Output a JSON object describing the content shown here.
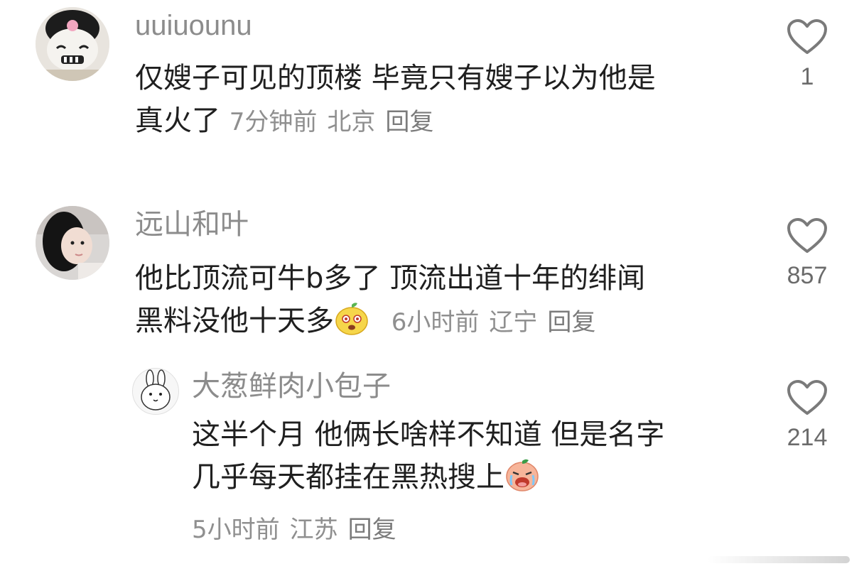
{
  "comments": [
    {
      "username": "uuiuounu",
      "text_line1": "仅嫂子可见的顶楼 毕竟只有嫂子以为他是",
      "text_line2": "真火了",
      "time": "7分钟前",
      "location": "北京",
      "reply_label": "回复",
      "likes": "1",
      "avatar_icon": "skull-character-avatar"
    },
    {
      "username": "远山和叶",
      "text_line1": "他比顶流可牛b多了 顶流出道十年的绯闻",
      "text_line2": "黑料没他十天多",
      "time": "6小时前",
      "location": "辽宁",
      "reply_label": "回复",
      "likes": "857",
      "avatar_icon": "girl-photo-avatar"
    },
    {
      "username": "大葱鲜肉小包子",
      "text_line1": "这半个月 他俩长啥样不知道 但是名字",
      "text_line2": "几乎每天都挂在黑热搜上",
      "time": "5小时前",
      "location": "江苏",
      "reply_label": "回复",
      "likes": "214",
      "avatar_icon": "bunny-doodle-avatar"
    }
  ],
  "colors": {
    "text": "#1f1f1f",
    "meta": "#8f8f8f",
    "username": "#8c8c8c",
    "heart": "#7a7a7a"
  }
}
